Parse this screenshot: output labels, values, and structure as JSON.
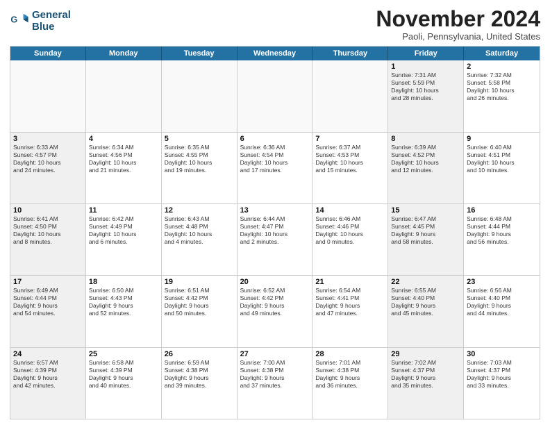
{
  "logo": {
    "line1": "General",
    "line2": "Blue"
  },
  "title": "November 2024",
  "subtitle": "Paoli, Pennsylvania, United States",
  "weekdays": [
    "Sunday",
    "Monday",
    "Tuesday",
    "Wednesday",
    "Thursday",
    "Friday",
    "Saturday"
  ],
  "rows": [
    [
      {
        "day": "",
        "info": "",
        "empty": true
      },
      {
        "day": "",
        "info": "",
        "empty": true
      },
      {
        "day": "",
        "info": "",
        "empty": true
      },
      {
        "day": "",
        "info": "",
        "empty": true
      },
      {
        "day": "",
        "info": "",
        "empty": true
      },
      {
        "day": "1",
        "info": "Sunrise: 7:31 AM\nSunset: 5:59 PM\nDaylight: 10 hours\nand 28 minutes.",
        "shaded": true
      },
      {
        "day": "2",
        "info": "Sunrise: 7:32 AM\nSunset: 5:58 PM\nDaylight: 10 hours\nand 26 minutes."
      }
    ],
    [
      {
        "day": "3",
        "info": "Sunrise: 6:33 AM\nSunset: 4:57 PM\nDaylight: 10 hours\nand 24 minutes.",
        "shaded": true
      },
      {
        "day": "4",
        "info": "Sunrise: 6:34 AM\nSunset: 4:56 PM\nDaylight: 10 hours\nand 21 minutes."
      },
      {
        "day": "5",
        "info": "Sunrise: 6:35 AM\nSunset: 4:55 PM\nDaylight: 10 hours\nand 19 minutes."
      },
      {
        "day": "6",
        "info": "Sunrise: 6:36 AM\nSunset: 4:54 PM\nDaylight: 10 hours\nand 17 minutes."
      },
      {
        "day": "7",
        "info": "Sunrise: 6:37 AM\nSunset: 4:53 PM\nDaylight: 10 hours\nand 15 minutes."
      },
      {
        "day": "8",
        "info": "Sunrise: 6:39 AM\nSunset: 4:52 PM\nDaylight: 10 hours\nand 12 minutes.",
        "shaded": true
      },
      {
        "day": "9",
        "info": "Sunrise: 6:40 AM\nSunset: 4:51 PM\nDaylight: 10 hours\nand 10 minutes."
      }
    ],
    [
      {
        "day": "10",
        "info": "Sunrise: 6:41 AM\nSunset: 4:50 PM\nDaylight: 10 hours\nand 8 minutes.",
        "shaded": true
      },
      {
        "day": "11",
        "info": "Sunrise: 6:42 AM\nSunset: 4:49 PM\nDaylight: 10 hours\nand 6 minutes."
      },
      {
        "day": "12",
        "info": "Sunrise: 6:43 AM\nSunset: 4:48 PM\nDaylight: 10 hours\nand 4 minutes."
      },
      {
        "day": "13",
        "info": "Sunrise: 6:44 AM\nSunset: 4:47 PM\nDaylight: 10 hours\nand 2 minutes."
      },
      {
        "day": "14",
        "info": "Sunrise: 6:46 AM\nSunset: 4:46 PM\nDaylight: 10 hours\nand 0 minutes."
      },
      {
        "day": "15",
        "info": "Sunrise: 6:47 AM\nSunset: 4:45 PM\nDaylight: 9 hours\nand 58 minutes.",
        "shaded": true
      },
      {
        "day": "16",
        "info": "Sunrise: 6:48 AM\nSunset: 4:44 PM\nDaylight: 9 hours\nand 56 minutes."
      }
    ],
    [
      {
        "day": "17",
        "info": "Sunrise: 6:49 AM\nSunset: 4:44 PM\nDaylight: 9 hours\nand 54 minutes.",
        "shaded": true
      },
      {
        "day": "18",
        "info": "Sunrise: 6:50 AM\nSunset: 4:43 PM\nDaylight: 9 hours\nand 52 minutes."
      },
      {
        "day": "19",
        "info": "Sunrise: 6:51 AM\nSunset: 4:42 PM\nDaylight: 9 hours\nand 50 minutes."
      },
      {
        "day": "20",
        "info": "Sunrise: 6:52 AM\nSunset: 4:42 PM\nDaylight: 9 hours\nand 49 minutes."
      },
      {
        "day": "21",
        "info": "Sunrise: 6:54 AM\nSunset: 4:41 PM\nDaylight: 9 hours\nand 47 minutes."
      },
      {
        "day": "22",
        "info": "Sunrise: 6:55 AM\nSunset: 4:40 PM\nDaylight: 9 hours\nand 45 minutes.",
        "shaded": true
      },
      {
        "day": "23",
        "info": "Sunrise: 6:56 AM\nSunset: 4:40 PM\nDaylight: 9 hours\nand 44 minutes."
      }
    ],
    [
      {
        "day": "24",
        "info": "Sunrise: 6:57 AM\nSunset: 4:39 PM\nDaylight: 9 hours\nand 42 minutes.",
        "shaded": true
      },
      {
        "day": "25",
        "info": "Sunrise: 6:58 AM\nSunset: 4:39 PM\nDaylight: 9 hours\nand 40 minutes."
      },
      {
        "day": "26",
        "info": "Sunrise: 6:59 AM\nSunset: 4:38 PM\nDaylight: 9 hours\nand 39 minutes."
      },
      {
        "day": "27",
        "info": "Sunrise: 7:00 AM\nSunset: 4:38 PM\nDaylight: 9 hours\nand 37 minutes."
      },
      {
        "day": "28",
        "info": "Sunrise: 7:01 AM\nSunset: 4:38 PM\nDaylight: 9 hours\nand 36 minutes."
      },
      {
        "day": "29",
        "info": "Sunrise: 7:02 AM\nSunset: 4:37 PM\nDaylight: 9 hours\nand 35 minutes.",
        "shaded": true
      },
      {
        "day": "30",
        "info": "Sunrise: 7:03 AM\nSunset: 4:37 PM\nDaylight: 9 hours\nand 33 minutes."
      }
    ]
  ]
}
